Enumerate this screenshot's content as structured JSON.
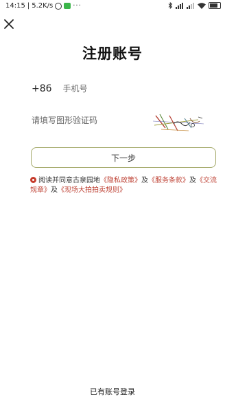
{
  "status_bar": {
    "time": "14:15",
    "separator": "|",
    "network_speed": "5.2K/s",
    "more_dots": "···"
  },
  "icons": {
    "close": "close-icon",
    "alarm": "alarm-icon",
    "wechat": "wechat-notification-icon",
    "bluetooth": "bluetooth-icon",
    "signal": "signal-icon",
    "wifi": "wifi-icon",
    "battery": "battery-icon",
    "agree": "radio-checked-icon"
  },
  "colors": {
    "accent_red": "#c0473a",
    "button_border": "#a4a96a"
  },
  "page": {
    "title": "注册账号"
  },
  "form": {
    "country_code": "+86",
    "phone_placeholder": "手机号",
    "captcha_placeholder": "请填写图形验证码",
    "next_label": "下一步"
  },
  "agreement": {
    "prefix": "阅读并同意古泉园地",
    "privacy": "《隐私政策》",
    "and1": "及",
    "service": "《服务条款》",
    "and2": "及",
    "exchange": "《交流规章》",
    "and3": "及",
    "auction": "《现场大拍拍卖规则》"
  },
  "footer": {
    "login_label": "已有账号登录"
  }
}
